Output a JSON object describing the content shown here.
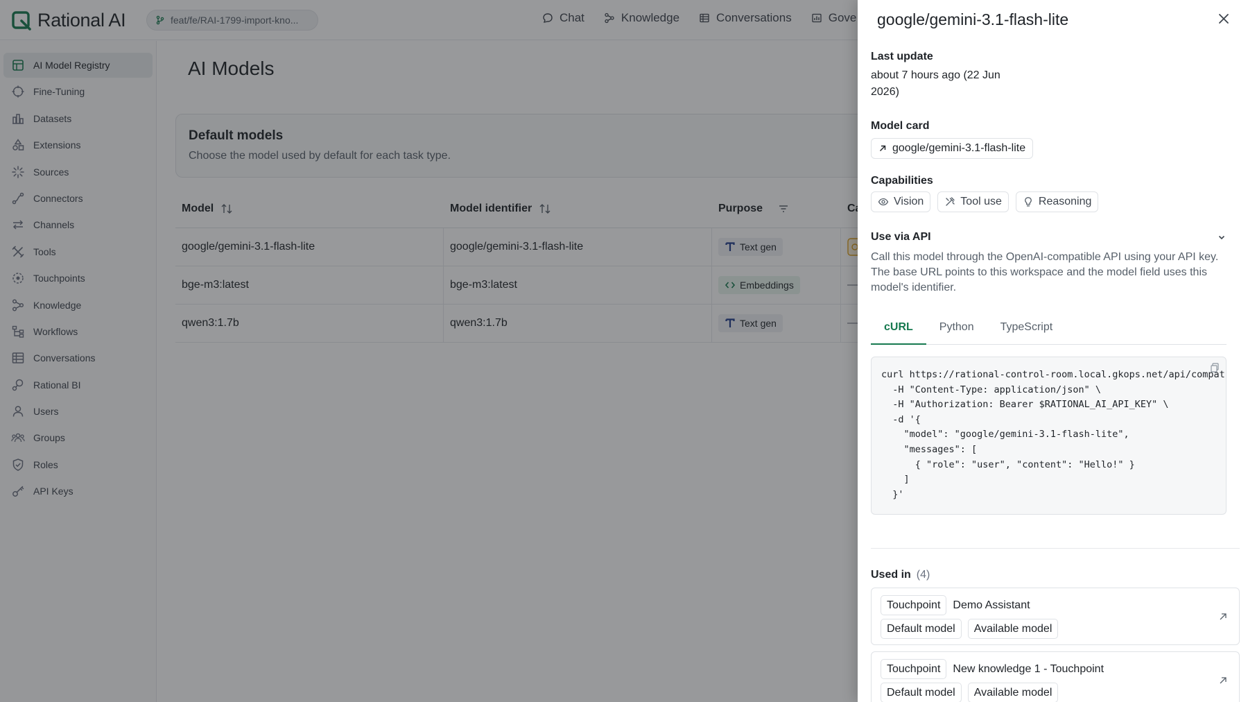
{
  "app": {
    "brand_name": "Rational AI",
    "branch": "feat/fe/RAI-1799-import-kno...",
    "colors": {
      "accent": "#16794f",
      "overlay": "#1e2126"
    }
  },
  "topnav": [
    {
      "label": "Chat",
      "icon": "chat-bubble-icon"
    },
    {
      "label": "Knowledge",
      "icon": "knowledge-graph-icon"
    },
    {
      "label": "Conversations",
      "icon": "table-icon"
    },
    {
      "label": "Gove",
      "icon": "bar-chart-icon"
    }
  ],
  "sidebar": {
    "items": [
      {
        "label": "AI Model Registry",
        "icon": "registry-icon",
        "active": true
      },
      {
        "label": "Fine-Tuning",
        "icon": "crosshair-icon"
      },
      {
        "label": "Datasets",
        "icon": "datasets-icon"
      },
      {
        "label": "Extensions",
        "icon": "shapes-icon"
      },
      {
        "label": "Sources",
        "icon": "sparkle-icon"
      },
      {
        "label": "Connectors",
        "icon": "connector-icon"
      },
      {
        "label": "Channels",
        "icon": "arrows-left-right-icon"
      },
      {
        "label": "Tools",
        "icon": "tools-icon"
      },
      {
        "label": "Touchpoints",
        "icon": "touchpoint-icon"
      },
      {
        "label": "Knowledge",
        "icon": "knowledge-graph-icon"
      },
      {
        "label": "Workflows",
        "icon": "workflow-icon"
      },
      {
        "label": "Conversations",
        "icon": "table-icon"
      },
      {
        "label": "Rational BI",
        "icon": "bi-icon"
      },
      {
        "label": "Users",
        "icon": "user-icon"
      },
      {
        "label": "Groups",
        "icon": "users-group-icon"
      },
      {
        "label": "Roles",
        "icon": "shield-check-icon"
      },
      {
        "label": "API Keys",
        "icon": "key-icon"
      }
    ]
  },
  "main": {
    "page_title": "AI Models",
    "defaults": {
      "title": "Default models",
      "subtitle": "Choose the model used by default for each task type."
    },
    "table": {
      "headers": {
        "model": "Model",
        "identifier": "Model identifier",
        "purpose": "Purpose",
        "capabilities": "Ca"
      },
      "rows": [
        {
          "model": "google/gemini-3.1-flash-lite",
          "identifier": "google/gemini-3.1-flash-lite",
          "purpose": "Text gen",
          "purpose_icon": "text-t-icon",
          "cap": ""
        },
        {
          "model": "bge-m3:latest",
          "identifier": "bge-m3:latest",
          "purpose": "Embeddings",
          "purpose_icon": "code-brackets-icon",
          "cap": "—"
        },
        {
          "model": "qwen3:1.7b",
          "identifier": "qwen3:1.7b",
          "purpose": "Text gen",
          "purpose_icon": "text-t-icon",
          "cap": "—"
        }
      ]
    }
  },
  "drawer": {
    "title": "google/gemini-3.1-flash-lite",
    "last_update_label": "Last update",
    "last_update_value": "about 7 hours ago (22 Jun 2026)",
    "model_card_label": "Model card",
    "model_card_link": "google/gemini-3.1-flash-lite",
    "capabilities_label": "Capabilities",
    "capabilities": [
      {
        "label": "Vision",
        "icon": "eye-icon"
      },
      {
        "label": "Tool use",
        "icon": "hammer-icon"
      },
      {
        "label": "Reasoning",
        "icon": "lightbulb-icon"
      }
    ],
    "api_label": "Use via API",
    "api_description": "Call this model through the OpenAI-compatible API using your API key. The base URL points to this workspace and the model field uses this model's identifier.",
    "tabs": [
      {
        "label": "cURL",
        "active": true
      },
      {
        "label": "Python",
        "active": false
      },
      {
        "label": "TypeScript",
        "active": false
      }
    ],
    "code": "curl https://rational-control-room.local.gkops.net/api/compat\n  -H \"Content-Type: application/json\" \\\n  -H \"Authorization: Bearer $RATIONAL_AI_API_KEY\" \\\n  -d '{\n    \"model\": \"google/gemini-3.1-flash-lite\",\n    \"messages\": [\n      { \"role\": \"user\", \"content\": \"Hello!\" }\n    ]\n  }'",
    "used_in_label": "Used in",
    "used_in_count": "(4)",
    "used_in": [
      {
        "type": "Touchpoint",
        "name": "Demo Assistant",
        "tags": [
          "Default model",
          "Available model"
        ]
      },
      {
        "type": "Touchpoint",
        "name": "New knowledge 1 - Touchpoint",
        "tags": [
          "Default model",
          "Available model"
        ]
      }
    ]
  }
}
